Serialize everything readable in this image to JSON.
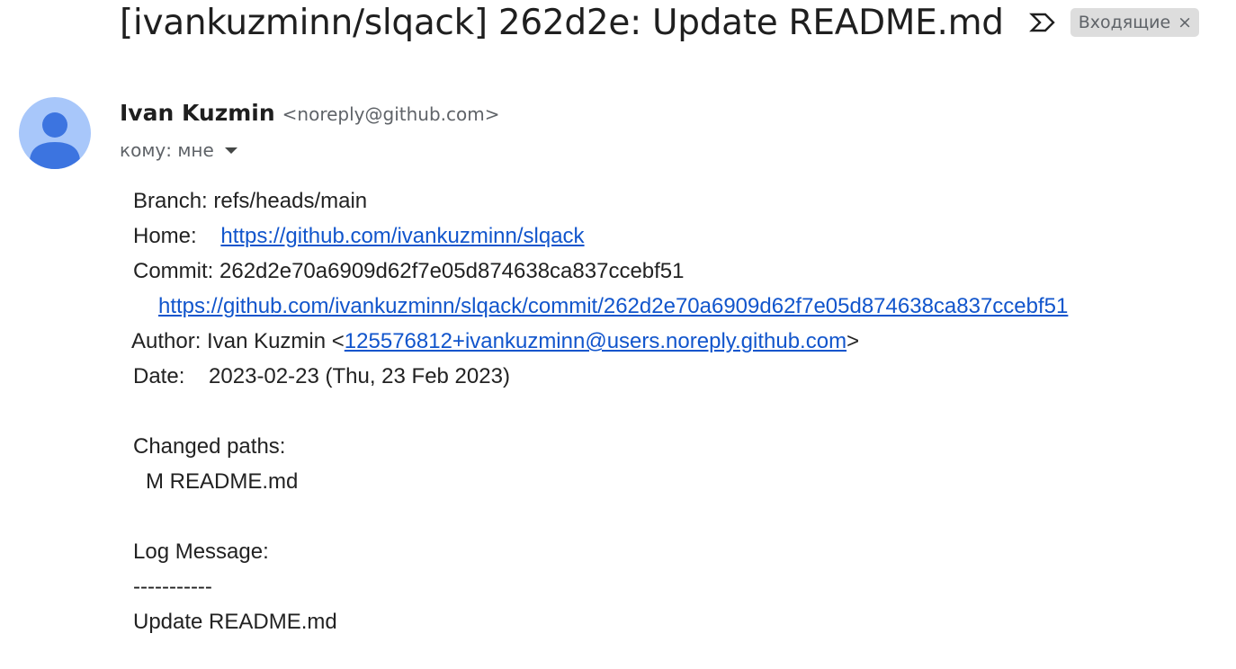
{
  "subject": "[ivankuzminn/slqack] 262d2e: Update README.md",
  "label": {
    "name": "Входящие",
    "remove": "×"
  },
  "icons": {
    "important": "important-marker-icon",
    "avatar": "default-avatar-icon",
    "dropdown": "caret-down-icon"
  },
  "sender": {
    "name": "Ivan Kuzmin",
    "email": "<noreply@github.com>"
  },
  "recipient": {
    "text": "кому: мне"
  },
  "body": {
    "branch": "Branch: refs/heads/main",
    "home_label": "Home:",
    "home_url": "https://github.com/ivankuzminn/slqack",
    "commit": "Commit: 262d2e70a6909d62f7e05d874638ca837ccebf51",
    "commit_url": "https://github.com/ivankuzminn/slqack/commit/262d2e70a6909d62f7e05d874638ca837ccebf51",
    "author_prefix": "Author: Ivan Kuzmin <",
    "author_email": "125576812+ivankuzminn@users.noreply.github.com",
    "author_suffix": ">",
    "date_label": "Date:",
    "date_value": "2023-02-23 (Thu, 23 Feb 2023)",
    "changed_paths_label": "Changed paths:",
    "changed_path": "M README.md",
    "log_message_label": "Log Message:",
    "separator": "-----------",
    "log_message": "Update README.md"
  },
  "colors": {
    "link": "#1155cc",
    "avatar_bg": "#a8c7fa",
    "avatar_fg": "#3c74e0",
    "chip_bg": "#dddddd"
  }
}
